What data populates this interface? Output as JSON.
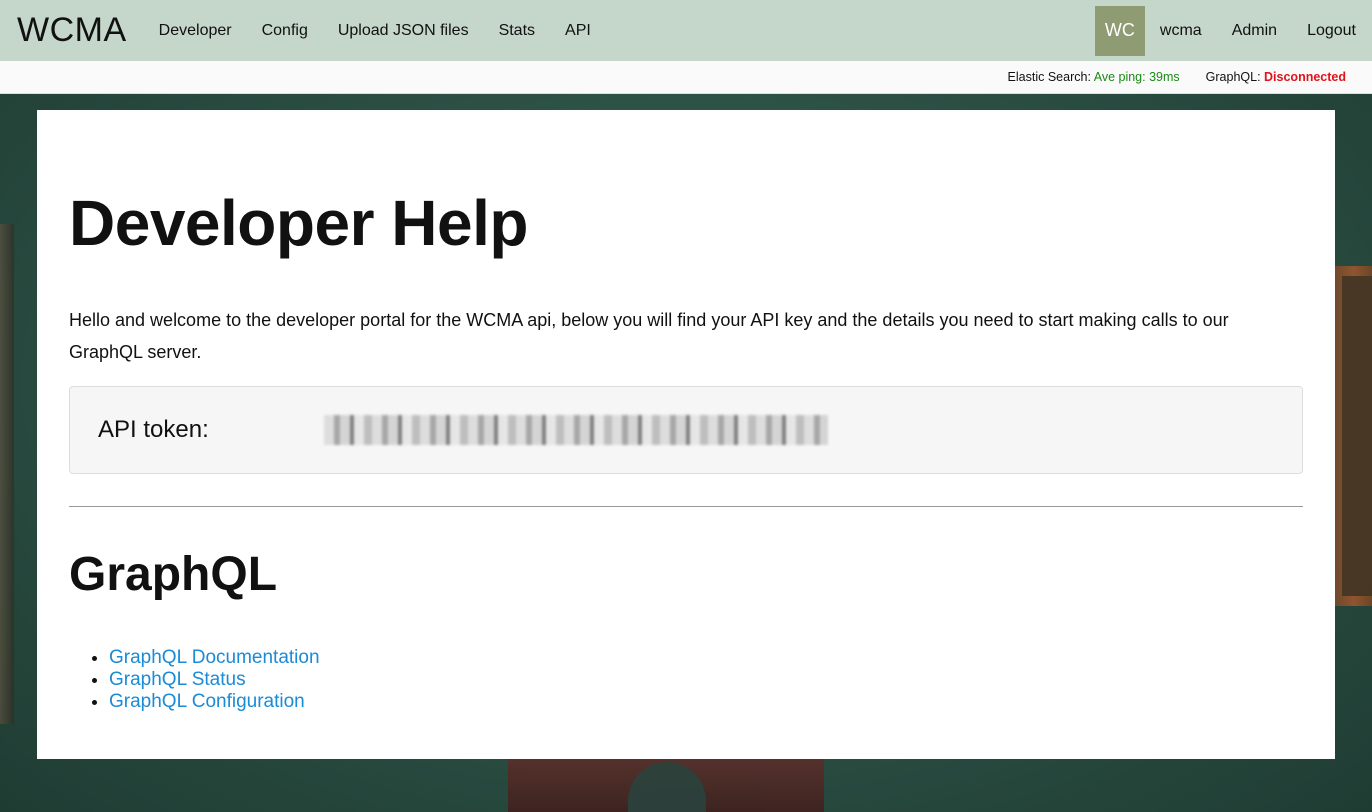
{
  "nav": {
    "brand": "WCMA",
    "links": [
      "Developer",
      "Config",
      "Upload JSON files",
      "Stats",
      "API"
    ],
    "avatar_initials": "WC",
    "user": "wcma",
    "admin": "Admin",
    "logout": "Logout"
  },
  "status": {
    "elastic_label": "Elastic Search:",
    "elastic_value": "Ave ping: 39ms",
    "graphql_label": "GraphQL:",
    "graphql_value": "Disconnected"
  },
  "main": {
    "title": "Developer Help",
    "intro": "Hello and welcome to the developer portal for the WCMA api, below you will find your API key and the details you need to start making calls to our GraphQL server.",
    "token_label": "API token:",
    "section_title": "GraphQL",
    "links": [
      "GraphQL Documentation",
      "GraphQL Status",
      "GraphQL Configuration"
    ]
  },
  "colors": {
    "navbar_bg": "#c5d6ca",
    "avatar_bg": "#8f9b72",
    "status_ok": "#1a8a16",
    "status_bad": "#e0131b",
    "link": "#1a8bd6"
  }
}
